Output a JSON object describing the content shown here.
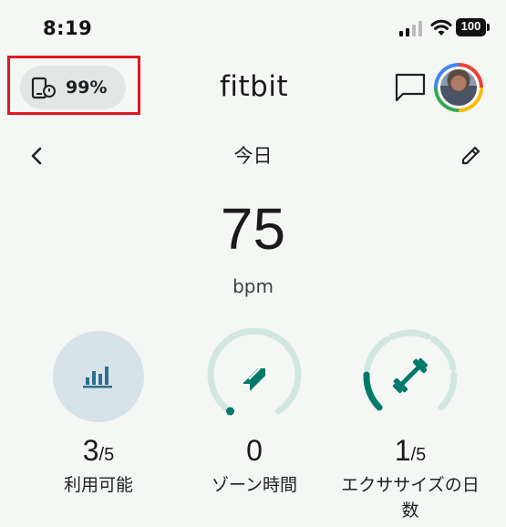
{
  "status_bar": {
    "time": "8:19",
    "battery": "100"
  },
  "device": {
    "battery_text": "99%",
    "icon": "device-sync-icon"
  },
  "header": {
    "brand": "fitbit",
    "chat_icon": "chat-icon",
    "avatar": "avatar"
  },
  "date_nav": {
    "label": "今日",
    "back_icon": "chevron-left-icon",
    "edit_icon": "pencil-icon"
  },
  "main": {
    "value": "75",
    "unit": "bpm"
  },
  "metrics": [
    {
      "id": "available",
      "value": "3",
      "denominator": "/5",
      "label": "利用可能",
      "icon": "bar-chart-icon"
    },
    {
      "id": "zone",
      "value": "0",
      "denominator": "",
      "label": "ゾーン時間",
      "icon": "arrow-icon"
    },
    {
      "id": "exercise",
      "value": "1",
      "denominator": "/5",
      "label": "エクササイズの日数",
      "icon": "dumbbell-icon",
      "progress": 0.2
    }
  ],
  "colors": {
    "accent": "#00796b",
    "ring_track": "#d2e7e2",
    "pill_bg": "#e3e6e4",
    "highlight": "#e0171f"
  }
}
